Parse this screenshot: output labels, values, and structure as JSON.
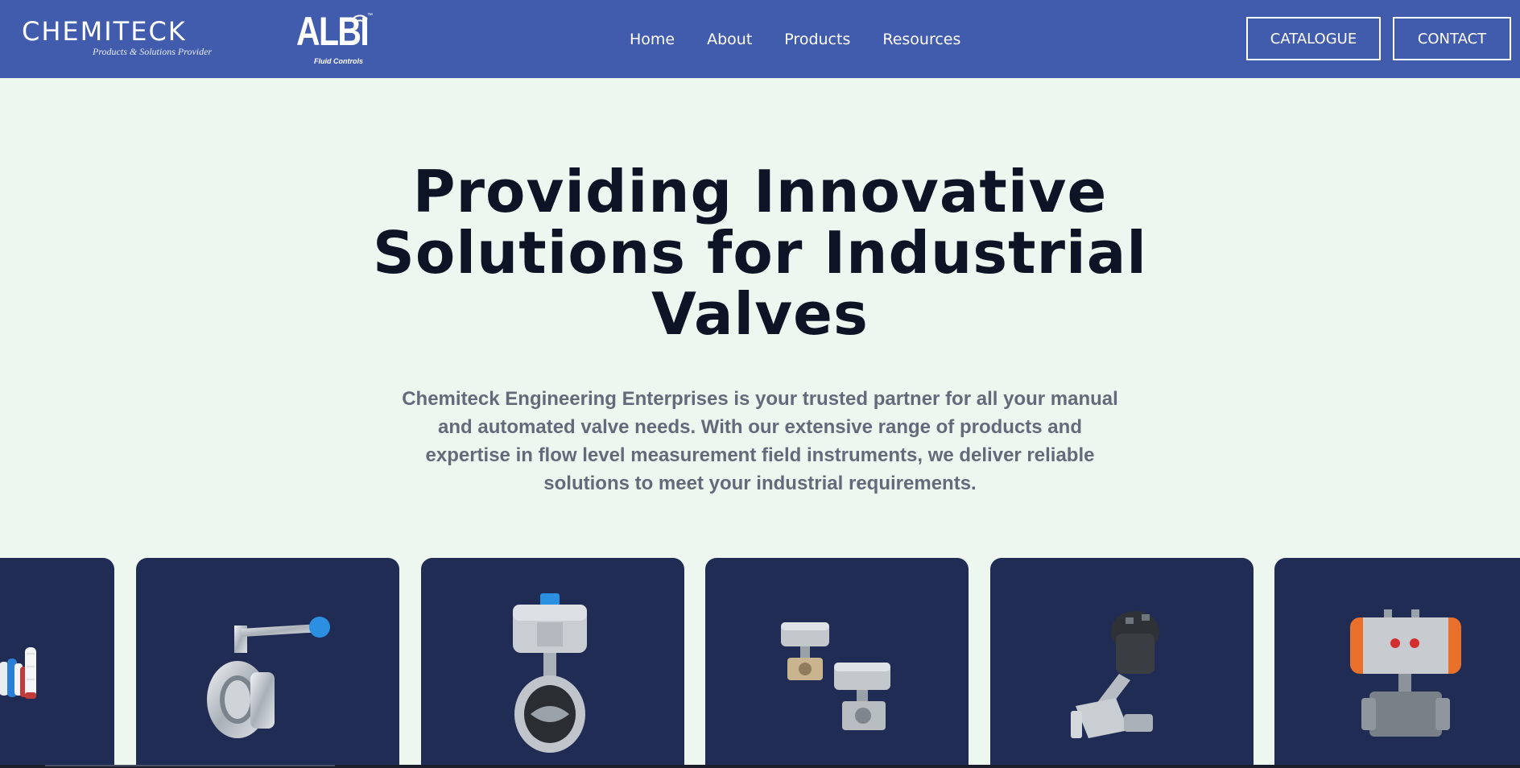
{
  "header": {
    "brand": {
      "name": "CHEMITECK",
      "tagline": "Products & Solutions Provider"
    },
    "partner": {
      "name": "ALBI",
      "subtitle": "Fluid Controls",
      "trademark": "™"
    },
    "nav": [
      {
        "label": "Home"
      },
      {
        "label": "About"
      },
      {
        "label": "Products"
      },
      {
        "label": "Resources"
      }
    ],
    "catalogue_label": "CATALOGUE",
    "contact_label": "CONTACT"
  },
  "hero": {
    "title_lines": [
      "Providing Innovative",
      "Solutions for Industrial",
      "Valves"
    ],
    "description_lines": [
      "Chemiteck Engineering Enterprises is your trusted partner for all your manual",
      "and automated valve needs. With our extensive range of products and",
      "expertise in flow level measurement field instruments, we deliver reliable",
      "solutions to meet your industrial requirements."
    ]
  },
  "products": [
    {
      "icon": "filter-cartridges-icon"
    },
    {
      "icon": "manual-butterfly-valve-icon"
    },
    {
      "icon": "pneumatic-butterfly-valve-icon"
    },
    {
      "icon": "three-way-actuated-ball-valves-icon"
    },
    {
      "icon": "angle-seat-valve-icon"
    },
    {
      "icon": "actuated-ball-valve-icon"
    }
  ],
  "colors": {
    "header_bg": "#425cad",
    "page_bg": "#eef7ef",
    "card_bg": "#212c55",
    "title": "#0d1426",
    "body_text": "#636b7a"
  }
}
